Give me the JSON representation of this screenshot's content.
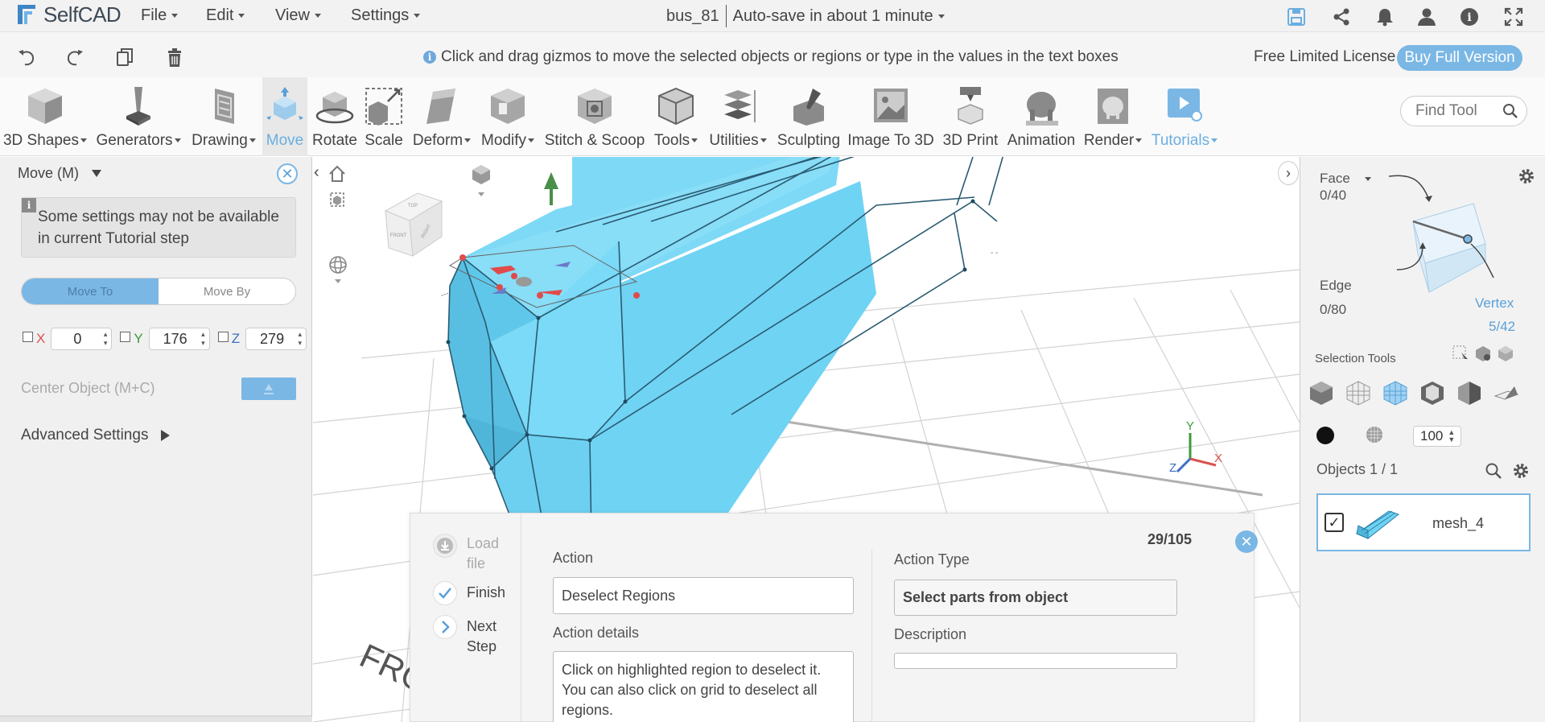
{
  "app": {
    "logo_text": "SelfCAD",
    "menus": [
      "File",
      "Edit",
      "View",
      "Settings"
    ],
    "project_name": "bus_81",
    "autosave_text": "Auto-save in about 1 minute",
    "top_icons": [
      "save-icon",
      "share-icon",
      "bell-icon",
      "user-icon",
      "help-icon",
      "fullscreen-icon"
    ]
  },
  "toolbar2": {
    "icons": [
      "undo-icon",
      "redo-icon",
      "copy-icon",
      "trash-icon"
    ],
    "hint": "Click and drag gizmos to move the selected objects or regions or type in the values in the text boxes",
    "license": "Free Limited License",
    "buy_button": "Buy Full Version"
  },
  "ribbon": {
    "tools": [
      {
        "label": "3D Shapes",
        "dropdown": true
      },
      {
        "label": "Generators",
        "dropdown": true
      },
      {
        "label": "Drawing",
        "dropdown": true
      },
      {
        "label": "Move",
        "dropdown": false,
        "active": true
      },
      {
        "label": "Rotate",
        "dropdown": false
      },
      {
        "label": "Scale",
        "dropdown": false
      },
      {
        "label": "Deform",
        "dropdown": true
      },
      {
        "label": "Modify",
        "dropdown": true
      },
      {
        "label": "Stitch & Scoop",
        "dropdown": false
      },
      {
        "label": "Tools",
        "dropdown": true
      },
      {
        "label": "Utilities",
        "dropdown": true
      },
      {
        "label": "Sculpting",
        "dropdown": false
      },
      {
        "label": "Image To 3D",
        "dropdown": false
      },
      {
        "label": "3D Print",
        "dropdown": false
      },
      {
        "label": "Animation",
        "dropdown": false
      },
      {
        "label": "Render",
        "dropdown": true
      },
      {
        "label": "Tutorials",
        "dropdown": true,
        "highlight": true
      }
    ],
    "find_tool_placeholder": "Find Tool"
  },
  "left_panel": {
    "title": "Move (M)",
    "warning": "Some settings may not be available in current Tutorial step",
    "mode_tabs": [
      "Move To",
      "Move By"
    ],
    "active_mode": "Move To",
    "coords": [
      {
        "axis": "X",
        "value": "0",
        "color": "#d9534f"
      },
      {
        "axis": "Y",
        "value": "176",
        "color": "#3c9a3c"
      },
      {
        "axis": "Z",
        "value": "279",
        "color": "#3a6fc4"
      }
    ],
    "center_object_label": "Center Object (M+C)",
    "advanced_label": "Advanced Settings"
  },
  "right_panel": {
    "face_label": "Face",
    "face_count": "0/40",
    "edge_label": "Edge",
    "edge_count": "0/80",
    "vertex_label": "Vertex",
    "vertex_count": "5/42",
    "selection_tools_label": "Selection Tools",
    "opacity_value": "100",
    "objects_label": "Objects 1 / 1",
    "object_name": "mesh_4"
  },
  "tutorial": {
    "steps": [
      {
        "label": "Load file",
        "state": "disabled"
      },
      {
        "label": "Finish",
        "state": "done"
      },
      {
        "label": "Next Step",
        "state": "next"
      }
    ],
    "counter": "29/105",
    "action_label": "Action",
    "action_value": "Deselect Regions",
    "details_label": "Action details",
    "details_value": "Click on highlighted region to deselect it. You can also click on grid to deselect all regions.",
    "action_type_label": "Action Type",
    "action_type_value": "Select parts from object",
    "description_label": "Description",
    "description_value": ""
  },
  "viewport": {
    "grid_text": "FRO",
    "view_cube_labels": [
      "FRONT",
      "RIGHT",
      "TOP"
    ],
    "axis_labels": [
      "X",
      "Y",
      "Z"
    ],
    "mesh_color": "#6fd3f3"
  },
  "colors": {
    "accent": "#7ab7e5",
    "accent_text": "#6aaee0"
  }
}
